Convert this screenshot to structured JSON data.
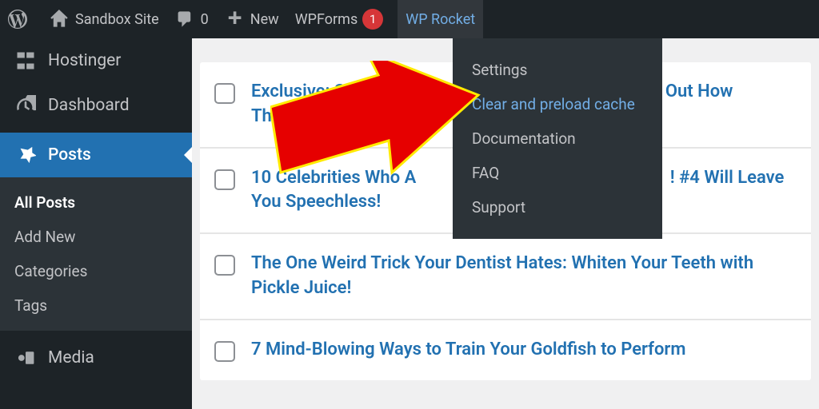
{
  "adminbar": {
    "site_name": "Sandbox Site",
    "comments_count": "0",
    "new_label": "New",
    "wpforms_label": "WPForms",
    "wpforms_badge": "1",
    "wprocket_label": "WP Rocket"
  },
  "wprocket_dropdown": {
    "items": [
      {
        "label": "Settings"
      },
      {
        "label": "Clear and preload cache"
      },
      {
        "label": "Documentation"
      },
      {
        "label": "FAQ"
      },
      {
        "label": "Support"
      }
    ]
  },
  "sidebar": {
    "items": [
      {
        "label": "Hostinger"
      },
      {
        "label": "Dashboard"
      },
      {
        "label": "Posts"
      },
      {
        "label": "Media"
      }
    ],
    "posts_submenu": [
      {
        "label": "All Posts"
      },
      {
        "label": "Add New"
      },
      {
        "label": "Categories"
      },
      {
        "label": "Tags"
      }
    ]
  },
  "posts": [
    {
      "title_prefix": "Exclusive: Sec",
      "title_suffix": "d Out How",
      "title_line2": "They're Pl"
    },
    {
      "title_prefix": "10 Celebrities Who A",
      "title_suffix": "! #4 Will Leave",
      "title_line2": "You Speechless!"
    },
    {
      "title": "The One Weird Trick Your Dentist Hates: Whiten Your Teeth with Pickle Juice!"
    },
    {
      "title": "7 Mind-Blowing Ways to Train Your Goldfish to Perform"
    }
  ]
}
